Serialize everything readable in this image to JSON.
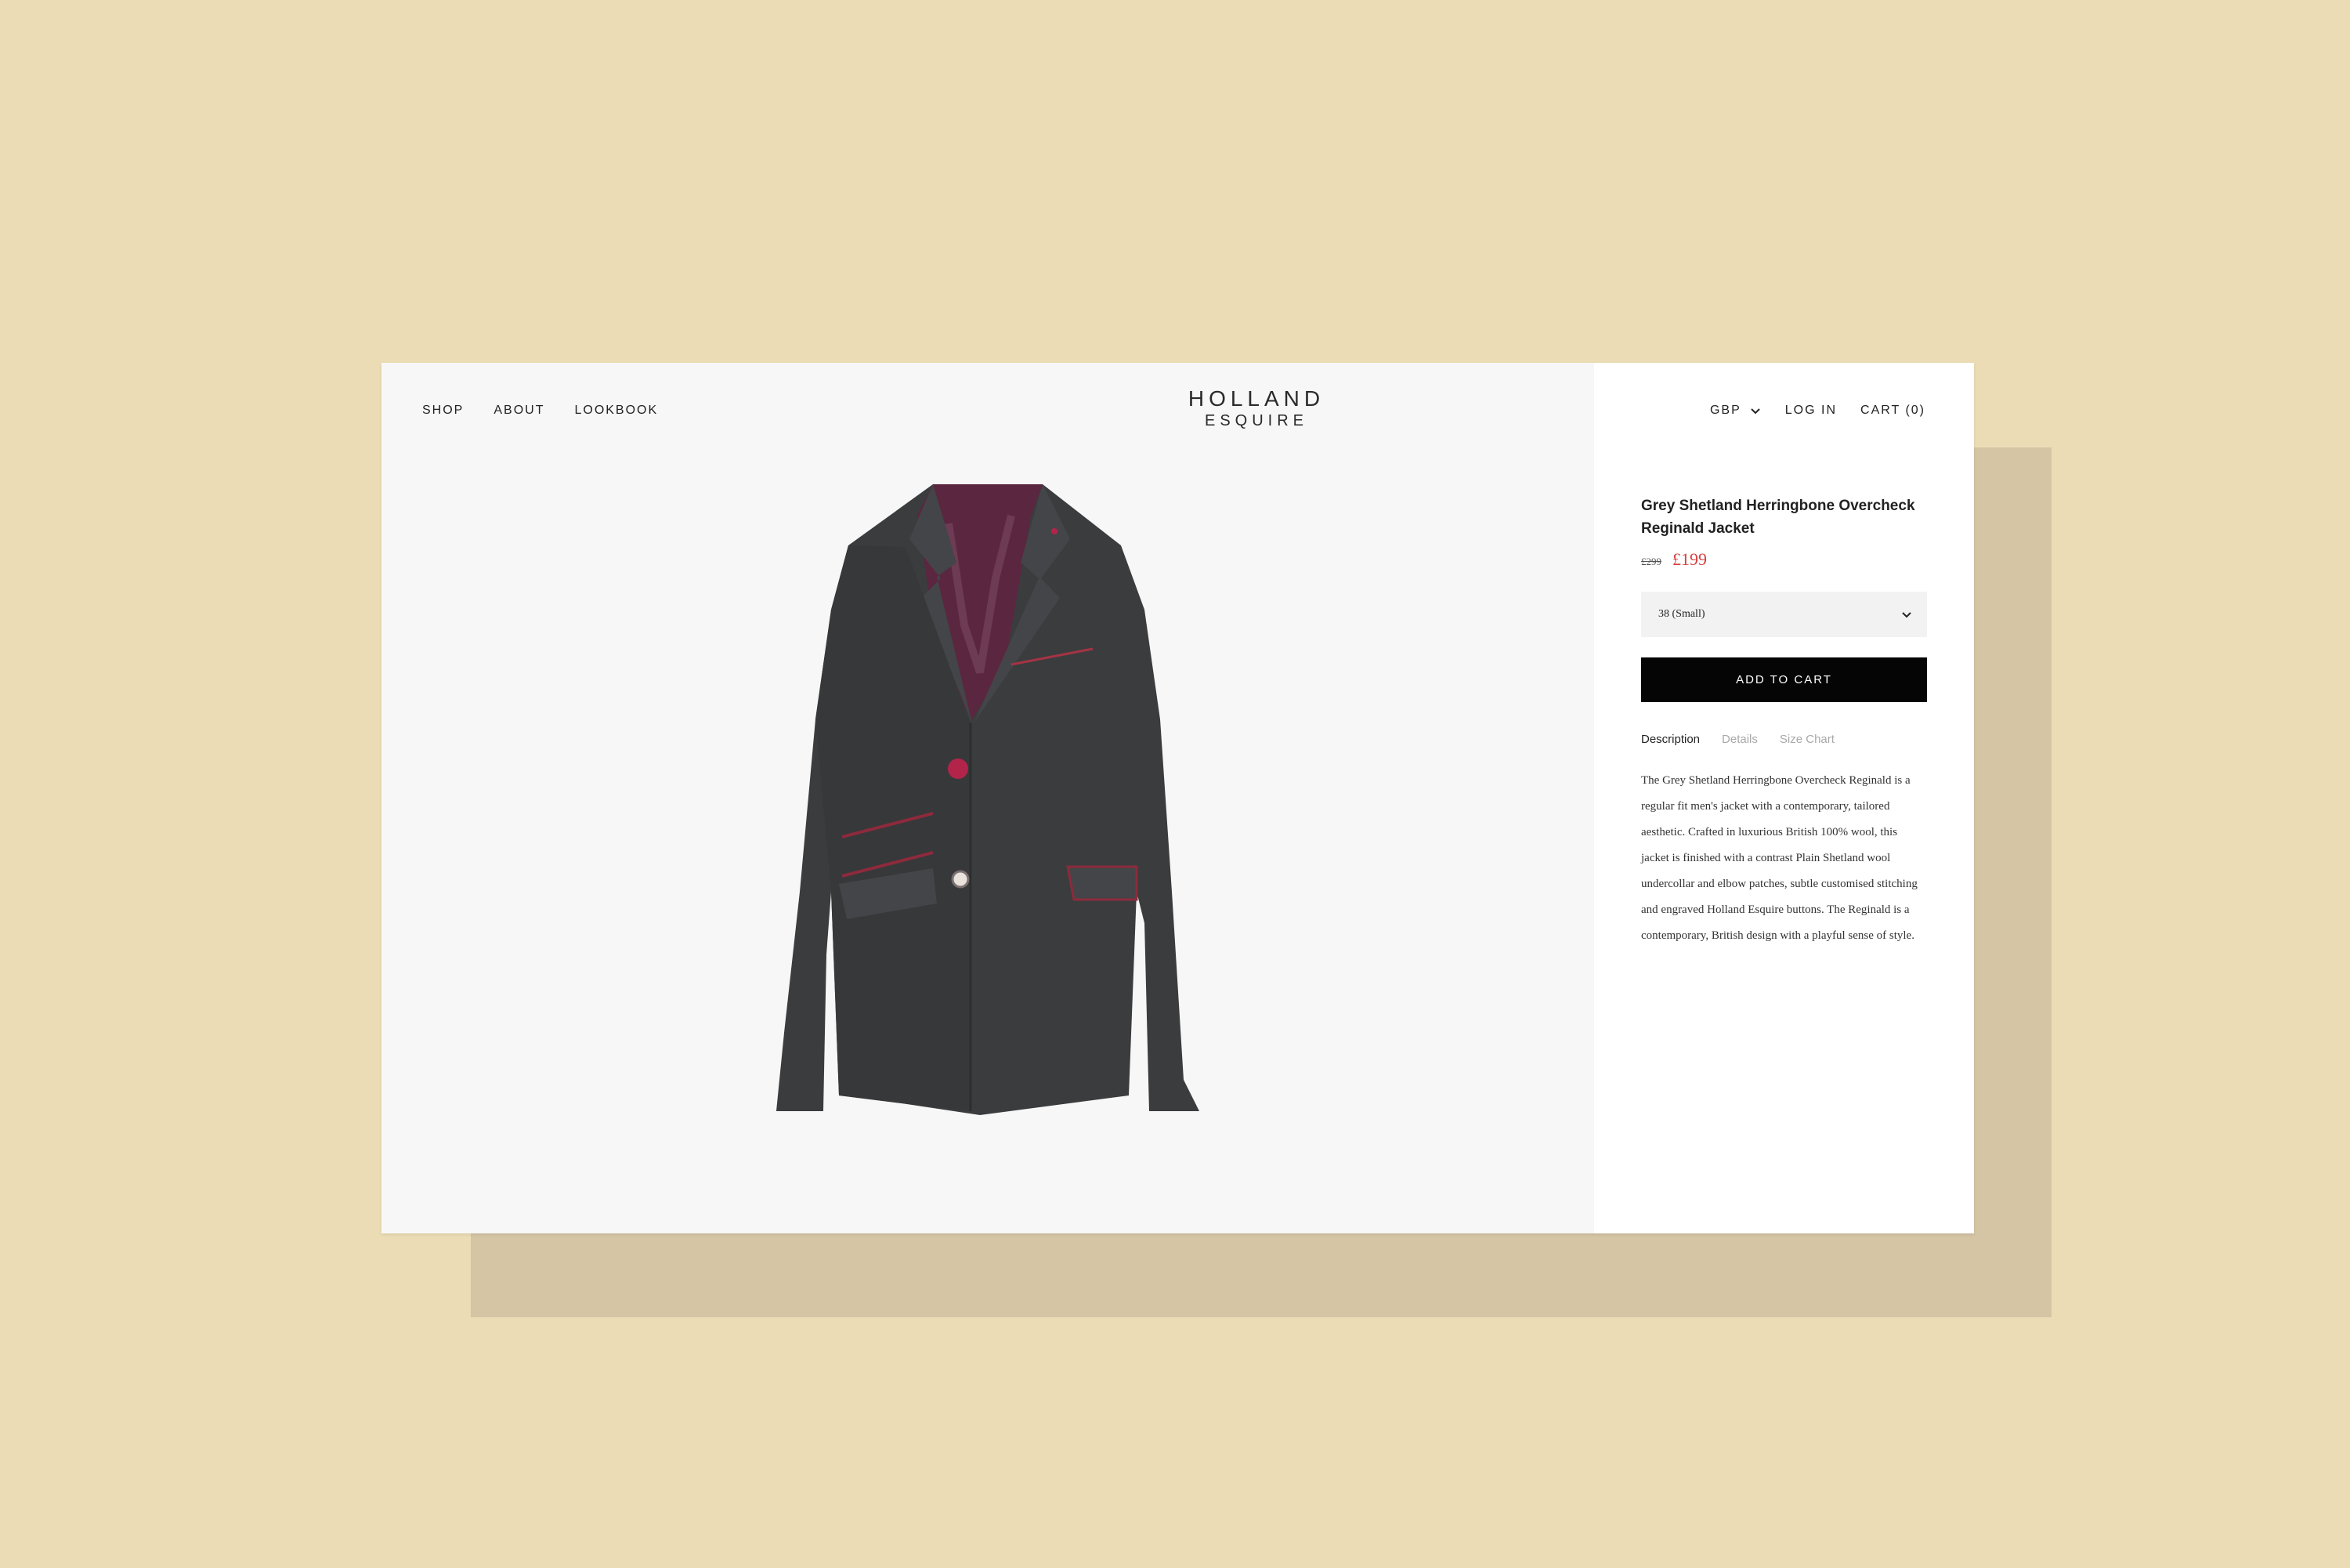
{
  "nav": {
    "shop": "SHOP",
    "about": "ABOUT",
    "lookbook": "LOOKBOOK"
  },
  "logo": {
    "line1": "HOLLAND",
    "line2": "ESQUIRE"
  },
  "utility": {
    "currency": "GBP",
    "login": "LOG IN",
    "cart": "CART (0)"
  },
  "product": {
    "title": "Grey Shetland Herringbone Overcheck Reginald Jacket",
    "old_price": "£299",
    "price": "£199",
    "size_selected": "38 (Small)",
    "add_to_cart": "ADD TO CART",
    "tabs": [
      "Description",
      "Details",
      "Size Chart"
    ],
    "description": "The Grey Shetland Herringbone Overcheck Reginald is a regular fit men's jacket with a contemporary, tailored aesthetic. Crafted in luxurious British 100% wool, this jacket is finished with a contrast Plain Shetland wool undercollar and elbow patches, subtle customised stitching and engraved Holland Esquire buttons. The Reginald is a contemporary, British design with a playful sense of style."
  },
  "colors": {
    "background": "#ecdcb5",
    "shadow_card": "#d5c5a5",
    "sale_price": "#d64040",
    "button": "#050505"
  }
}
